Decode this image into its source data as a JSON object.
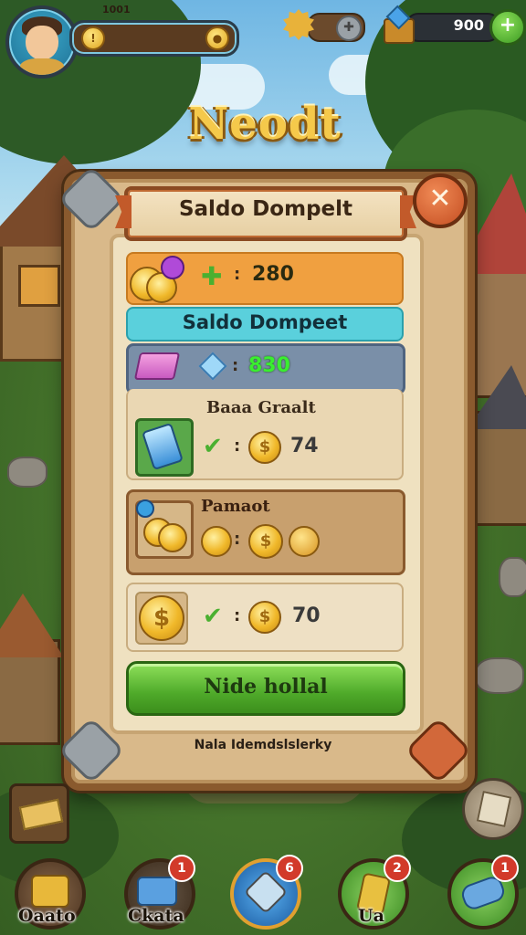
{
  "hud": {
    "level_text": "1001",
    "currency_value": "900",
    "add_symbol": "+"
  },
  "game_title": "Neodt",
  "panel": {
    "title": "Saldo Dompelt",
    "close_symbol": "✕",
    "rows": {
      "row1_value": "280",
      "row2_label": "Saldo Dompeet",
      "row3_value": "830",
      "row4_label": "Baaa Graalt",
      "row4_value": "74",
      "row5_label": "Pamaot",
      "row6_value": "70"
    },
    "action_button": "Nide hollal",
    "footer_note": "Nala Idemdslslerky"
  },
  "bottom_nav": [
    {
      "label": "Oaato",
      "badge": ""
    },
    {
      "label": "Ckata",
      "badge": "1"
    },
    {
      "label": "",
      "badge": "6"
    },
    {
      "label": "Ua",
      "badge": "2"
    },
    {
      "label": "",
      "badge": "1"
    }
  ],
  "colors": {
    "panel_border": "#8a5a2e",
    "action_green": "#4faa2a",
    "close_orange": "#c44e22",
    "gold": "#f0b82a"
  },
  "icons": [
    "avatar",
    "coin-icon",
    "gear-icon",
    "treasure-chest-icon",
    "plus-icon",
    "close-icon",
    "diamond-icon",
    "eraser-icon",
    "phone-card-icon",
    "check-icon",
    "map-icon"
  ]
}
